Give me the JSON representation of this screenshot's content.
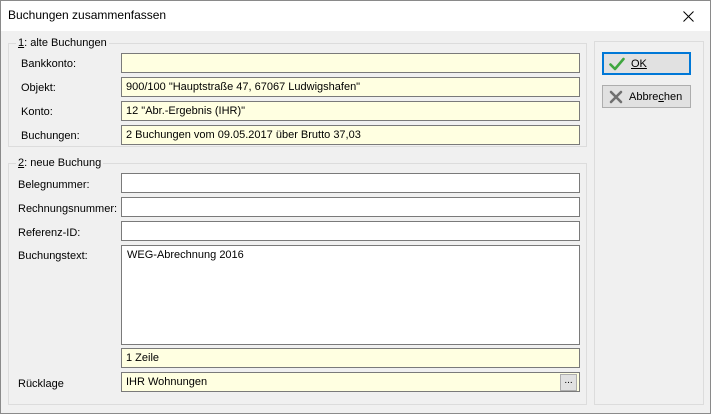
{
  "window": {
    "title": "Buchungen zusammenfassen"
  },
  "group1": {
    "title_key": "1",
    "title_rest": ": alte Buchungen",
    "bankkonto": {
      "label": "Bankkonto:",
      "value": ""
    },
    "objekt": {
      "label": "Objekt:",
      "value": "900/100 \"Hauptstraße 47, 67067 Ludwigshafen\""
    },
    "konto": {
      "label": "Konto:",
      "value": "12 \"Abr.-Ergebnis (IHR)\""
    },
    "buchungen": {
      "label": "Buchungen:",
      "value": "2 Buchungen vom 09.05.2017 über Brutto 37,03"
    }
  },
  "group2": {
    "title_key": "2",
    "title_rest": ": neue Buchung",
    "belegnummer": {
      "label": "Belegnummer:",
      "value": ""
    },
    "rechnungsnummer": {
      "label": "Rechnungsnummer:",
      "value": ""
    },
    "referenz": {
      "label": "Referenz-ID:",
      "value": ""
    },
    "buchungstext": {
      "label": "Buchungstext:",
      "value": "WEG-Abrechnung 2016"
    },
    "zeilen": "1 Zeile",
    "ruecklage": {
      "label": "Rücklage",
      "value": "IHR Wohnungen",
      "browse": "..."
    }
  },
  "buttons": {
    "ok": "OK",
    "cancel_pre": "Abbre",
    "cancel_key": "c",
    "cancel_post": "hen"
  },
  "colors": {
    "readonly_bg": "#ffffe1",
    "ok_check": "#3fa63f",
    "cancel_x": "#707070"
  }
}
